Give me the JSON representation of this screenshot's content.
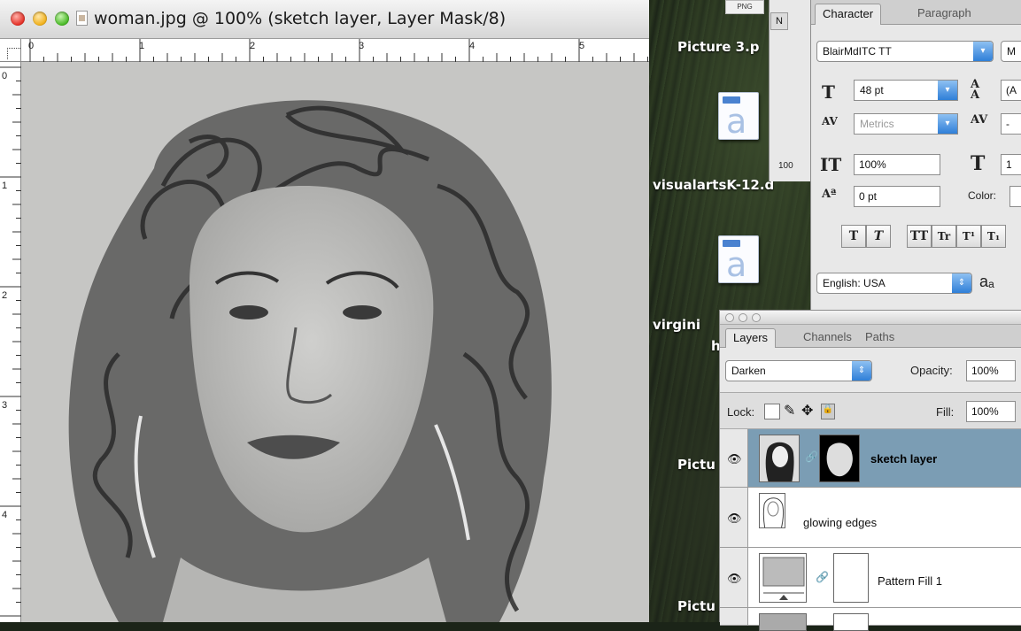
{
  "document": {
    "title": "woman.jpg @ 100% (sketch layer, Layer Mask/8)",
    "ruler_top": [
      "0",
      "1",
      "2",
      "3",
      "4",
      "5"
    ],
    "ruler_left": [
      "0",
      "1",
      "2",
      "3",
      "4"
    ]
  },
  "desktop": {
    "png_label": "PNG",
    "items": [
      {
        "label": "Picture 3.p"
      },
      {
        "label": "visualartsK-12.d"
      },
      {
        "label": "virgini"
      },
      {
        "label": "h"
      },
      {
        "label": "Pictu"
      },
      {
        "label": "Pictu"
      }
    ],
    "peek_tab": "N",
    "peek_text": "100"
  },
  "character_panel": {
    "tabs": [
      "Character",
      "Paragraph"
    ],
    "font_family": "BlairMdITC TT",
    "font_style": "M",
    "font_size": "48 pt",
    "leading": "(A",
    "kerning": "Metrics",
    "tracking": "-",
    "vertical_scale": "100%",
    "horizontal_scale": "1",
    "baseline_shift": "0 pt",
    "color_label": "Color:",
    "format_buttons": [
      "T",
      "T",
      "TT",
      "Tr",
      "T¹",
      "T₁"
    ],
    "language": "English: USA",
    "antialias_icon": "aₐ"
  },
  "layers_panel": {
    "tabs": [
      "Layers",
      "Channels",
      "Paths"
    ],
    "blend_mode": "Darken",
    "opacity_label": "Opacity:",
    "opacity_value": "100%",
    "lock_label": "Lock:",
    "fill_label": "Fill:",
    "fill_value": "100%",
    "layers": [
      {
        "name": "sketch layer",
        "selected": true,
        "visible": true
      },
      {
        "name": "glowing edges",
        "selected": false,
        "visible": true
      },
      {
        "name": "Pattern Fill 1",
        "selected": false,
        "visible": true
      }
    ]
  },
  "colors": {
    "selected_layer": "#7b9db4",
    "panel_bg": "#e8e8e8",
    "select_arrow": "#2f7fd8"
  }
}
